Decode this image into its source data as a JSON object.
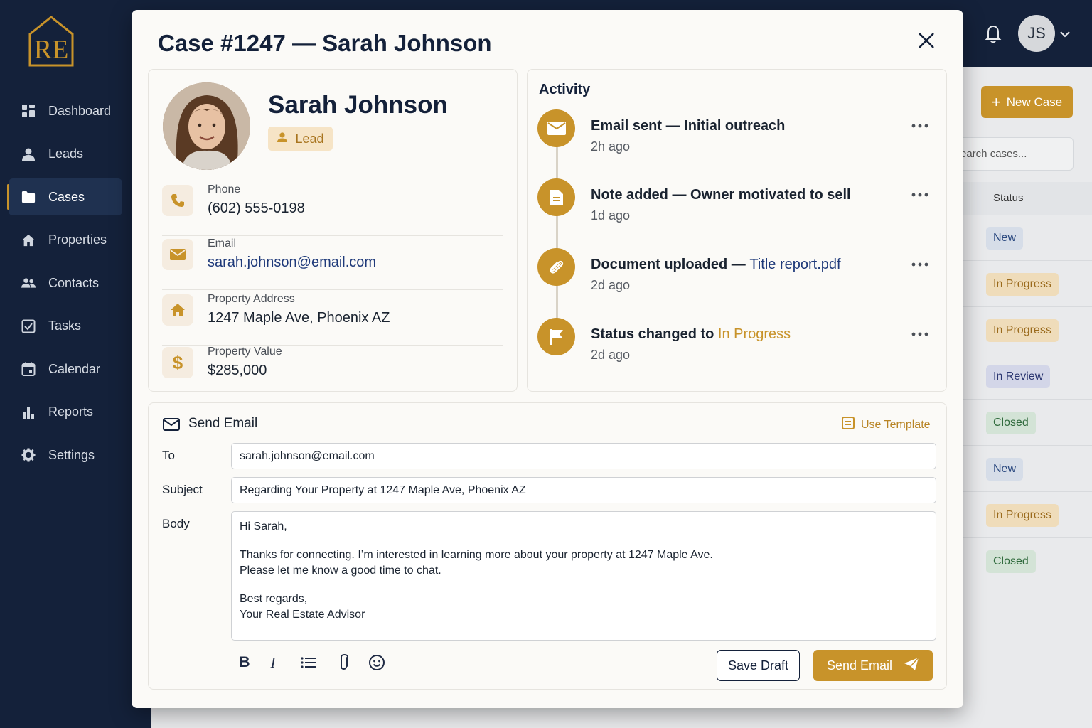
{
  "app": {
    "logo_text": "RE",
    "brand_color": "#c8932a",
    "sidebar_color": "#14213a"
  },
  "sidebar": {
    "items": [
      {
        "label": "Dashboard",
        "icon": "dashboard-grid-icon",
        "active": false
      },
      {
        "label": "Leads",
        "icon": "person-icon",
        "active": false
      },
      {
        "label": "Cases",
        "icon": "folder-icon",
        "active": true
      },
      {
        "label": "Properties",
        "icon": "home-icon",
        "active": false
      },
      {
        "label": "Contacts",
        "icon": "people-icon",
        "active": false
      },
      {
        "label": "Tasks",
        "icon": "checkbox-icon",
        "active": false
      },
      {
        "label": "Calendar",
        "icon": "calendar-icon",
        "active": false
      },
      {
        "label": "Reports",
        "icon": "bar-chart-icon",
        "active": false
      },
      {
        "label": "Settings",
        "icon": "gear-icon",
        "active": false
      }
    ]
  },
  "topbar": {
    "user_initials": "JS"
  },
  "background": {
    "new_case_label": "New Case",
    "search_placeholder": "earch cases...",
    "status_header": "Status",
    "statuses": [
      "New",
      "In Progress",
      "In Progress",
      "In Review",
      "Closed",
      "New",
      "In Progress",
      "Closed"
    ]
  },
  "modal": {
    "title": "Case #1247 — Sarah Johnson",
    "profile": {
      "name": "Sarah Johnson",
      "badge": "Lead",
      "fields": [
        {
          "label": "Phone",
          "value": "(602) 555-0198",
          "icon": "phone-icon"
        },
        {
          "label": "Email",
          "value": "sarah.johnson@email.com",
          "icon": "envelope-icon"
        },
        {
          "label": "Property Address",
          "value": "1247 Maple Ave, Phoenix AZ",
          "icon": "home-icon"
        },
        {
          "label": "Property Value",
          "value": "$285,000",
          "icon": "dollar-icon"
        }
      ]
    },
    "activity": {
      "title": "Activity",
      "items": [
        {
          "text": "Email sent — Initial outreach",
          "highlight": "",
          "time": "2h ago",
          "icon": "envelope-icon"
        },
        {
          "text": "Note added — Owner motivated to sell",
          "highlight": "",
          "time": "1d ago",
          "icon": "document-icon"
        },
        {
          "text": "Document uploaded — ",
          "highlight": "Title report.pdf",
          "time": "2d ago",
          "icon": "paperclip-icon"
        },
        {
          "text": "Status changed to ",
          "highlight": "In Progress",
          "time": "2d ago",
          "icon": "flag-icon"
        }
      ]
    },
    "email": {
      "title": "Send Email",
      "use_template": "Use Template",
      "to_label": "To",
      "to_value": "sarah.johnson@email.com",
      "subject_label": "Subject",
      "subject_value": "Regarding Your Property at 1247 Maple Ave, Phoenix AZ",
      "body_label": "Body",
      "body": {
        "greeting": "Hi Sarah,",
        "line1": "Thanks for connecting. I’m interested in learning more about your property at 1247 Maple Ave.",
        "line2": "Please let me know a good time to chat.",
        "closing": "Best regards,",
        "signature": "Your Real Estate Advisor"
      },
      "save_draft": "Save Draft",
      "send": "Send Email"
    }
  }
}
